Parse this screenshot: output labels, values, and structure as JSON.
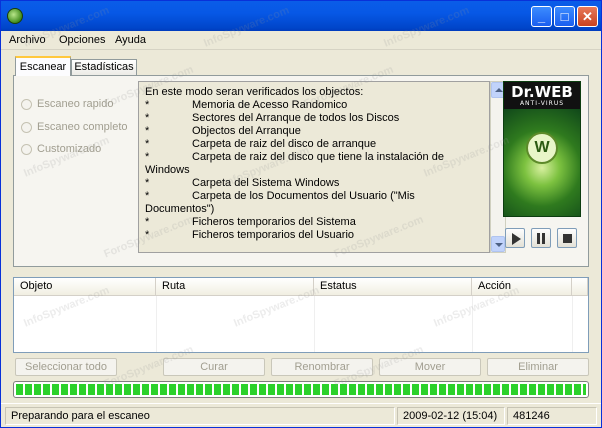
{
  "window": {
    "icon": "dr-web-spider-icon",
    "controls": [
      "minimize-icon",
      "maximize-icon",
      "close-icon"
    ]
  },
  "menu": {
    "items": [
      "Archivo",
      "Opciones",
      "Ayuda"
    ]
  },
  "tabs": [
    {
      "label": "Escanear",
      "active": true
    },
    {
      "label": "Estadísticas",
      "active": false
    }
  ],
  "scan_modes": [
    {
      "label": "Escaneo rapido",
      "selected": false
    },
    {
      "label": "Escaneo completo",
      "selected": false
    },
    {
      "label": "Customizado",
      "selected": false
    }
  ],
  "info": {
    "intro": "En este modo seran verificados los objectos:",
    "bullet": "*",
    "items": [
      "Memoria de Acesso Randomico",
      "Sectores del Arranque de todos los Discos",
      "Objectos del Arranque",
      "Carpeta de raiz del disco de arranque",
      "Carpeta de raiz del disco que tiene la instalación de",
      "Carpeta del Sistema Windows",
      "Carpeta de los Documentos del Usuario (\"Mis",
      "Ficheros temporarios del Sistema",
      "Ficheros temporarios del Usuario"
    ],
    "wrap1": "Windows",
    "wrap2": "Documentos\")"
  },
  "logo": {
    "title": "Dr.WEB",
    "subtitle": "ANTI-VIRUS",
    "mark": "W"
  },
  "media_controls": [
    "play-icon",
    "pause-icon",
    "stop-icon"
  ],
  "table": {
    "columns": [
      "Objeto",
      "Ruta",
      "Estatus",
      "Acción"
    ],
    "rows": []
  },
  "actions": {
    "select_all": "Seleccionar todo",
    "cure": "Curar",
    "rename": "Renombrar",
    "move": "Mover",
    "delete": "Eliminar"
  },
  "progress": {
    "value_percent": 100,
    "color": "#2bd12b"
  },
  "status": {
    "message": "Preparando para el escaneo",
    "datetime": "2009-02-12 (15:04)",
    "count": "481246"
  },
  "watermark": {
    "text": "InfoSpyware.com",
    "alt_text": "ForoSpyware.com",
    "amp": "&"
  }
}
